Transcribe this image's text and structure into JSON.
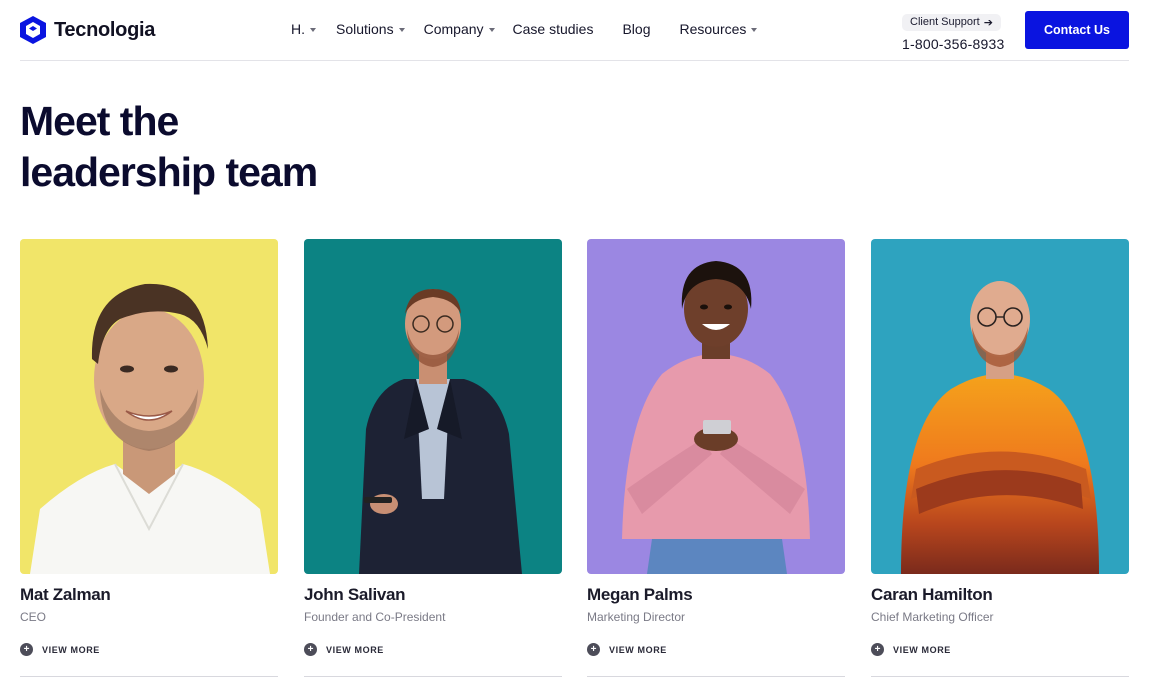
{
  "brand": {
    "name": "Tecnologia",
    "accent": "#0a14e0"
  },
  "nav": {
    "items": [
      {
        "label": "H.",
        "dropdown": true
      },
      {
        "label": "Solutions",
        "dropdown": true
      },
      {
        "label": "Company",
        "dropdown": true
      },
      {
        "label": "Case studies",
        "dropdown": false
      },
      {
        "label": "Blog",
        "dropdown": false
      },
      {
        "label": "Resources",
        "dropdown": true
      }
    ]
  },
  "support": {
    "label": "Client Support",
    "icon": "arrow-right-icon",
    "phone": "1-800-356-8933"
  },
  "cta": {
    "label": "Contact Us"
  },
  "page": {
    "title": "Meet the leadership team"
  },
  "team": [
    {
      "name": "Mat Zalman",
      "role": "CEO",
      "link": "VIEW MORE",
      "photo_bg": "#f3e86a"
    },
    {
      "name": "John Salivan",
      "role": "Founder and Co-President",
      "link": "VIEW MORE",
      "photo_bg": "#0e8c8c"
    },
    {
      "name": "Megan Palms",
      "role": "Marketing Director",
      "link": "VIEW MORE",
      "photo_bg": "#9a86e0"
    },
    {
      "name": "Caran Hamilton",
      "role": "Chief Marketing Officer",
      "link": "VIEW MORE",
      "photo_bg": "#2fa3bd"
    }
  ]
}
